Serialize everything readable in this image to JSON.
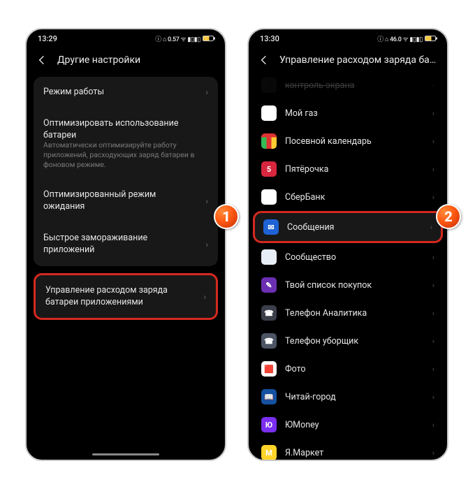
{
  "badges": {
    "one": "1",
    "two": "2"
  },
  "left": {
    "time": "13:29",
    "status_icons": "ⓘ ⌂ 0.57 ᯤ ▮▯▮▯",
    "title": "Другие настройки",
    "rows": {
      "mode": "Режим работы",
      "optimize_title": "Оптимизировать использование батареи",
      "optimize_sub": "Автоматически оптимизируйте работу приложений, расходующих заряд батареи в фоновом режиме.",
      "standby": "Оптимизированный режим ожидания",
      "freeze": "Быстрое замораживание приложений",
      "manage": "Управление расходом заряда батареи приложениями"
    }
  },
  "right": {
    "time": "13:30",
    "status_icons": "ⓘ ⌂ 46.0 ᯤ ▮▯▮▯",
    "title": "Управление расходом заряда батареи прил..",
    "apps": {
      "cut": "контроль экрана",
      "a1": "Мой газ",
      "a2": "Посевной календарь",
      "a3": "Пятёрочка",
      "a4": "СберБанк",
      "a5": "Сообщения",
      "a6": "Сообщество",
      "a7": "Твой список покупок",
      "a8": "Телефон Аналитика",
      "a9": "Телефон уборщик",
      "a10": "Фото",
      "a11": "Читай-город",
      "a12": "ЮMoney",
      "a13": "Я.Маркет"
    },
    "icon_glyph": {
      "a3": "5",
      "a4": "✓",
      "a12": "Ю",
      "a13": "M"
    }
  }
}
